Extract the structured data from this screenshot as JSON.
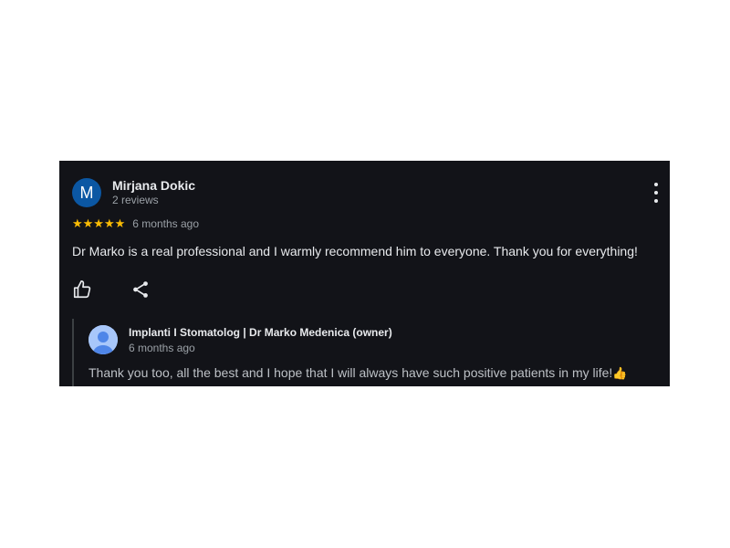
{
  "review": {
    "author_initial": "M",
    "author_name": "Mirjana Dokic",
    "author_meta": "2 reviews",
    "rating": 5,
    "stars": "★★★★★",
    "time": "6 months ago",
    "text": "Dr Marko is a real professional and I warmly recommend him to everyone. Thank you for everything!",
    "actions": {
      "like_icon": "thumbs-up-icon",
      "share_icon": "share-icon",
      "more_icon": "more-vertical-icon"
    }
  },
  "owner_reply": {
    "name": "Implanti I Stomatolog | Dr Marko Medenica (owner)",
    "time": "6 months ago",
    "text": "Thank you too, all the best and I hope that I will always have such positive patients in my life!",
    "emoji": "👍",
    "avatar_icon": "default-person-avatar-icon"
  },
  "colors": {
    "card_background": "#121318",
    "star": "#fbbc04",
    "avatar": "#0b57a3",
    "owner_avatar": "#a8c7fa"
  }
}
